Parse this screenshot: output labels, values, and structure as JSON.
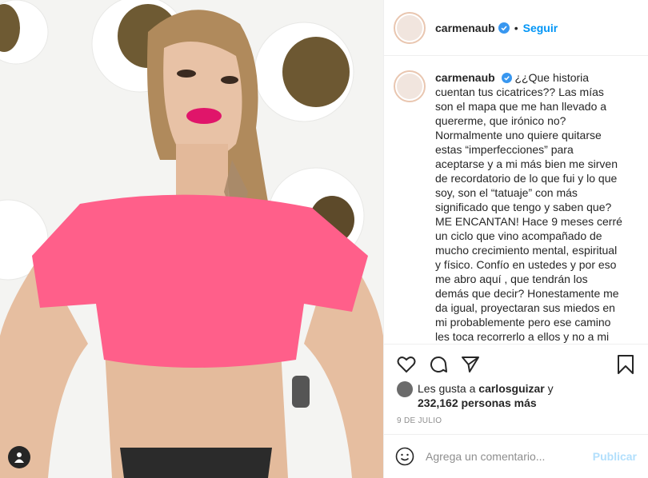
{
  "post": {
    "username": "carmenaub",
    "follow_label": "Seguir",
    "dot": "•",
    "caption_user": "carmenaub",
    "caption_lines": [
      "¿¿Que historia",
      "cuentan tus cicatrices?? Las mías",
      "son el mapa que me han llevado a",
      "quererme, que irónico no?",
      "Normalmente uno quiere quitarse",
      "estas “imperfecciones” para",
      "aceptarse y a mi más bien me sirven",
      "de recordatorio de lo que fui y lo que",
      "soy, son el “tatuaje” con más",
      "significado que tengo y saben que?",
      "ME ENCANTAN! Hace 9 meses cerré",
      "un ciclo que vino acompañado de",
      "mucho crecimiento mental, espiritual",
      "y físico. Confío en ustedes y por eso",
      "me abro aquí , que tendrán los",
      "demás que decir? Honestamente me",
      "da igual, proyectaran sus miedos en",
      "mi probablemente pero ese camino",
      "les toca recorrerlo a ellos y no a mi"
    ],
    "likes": {
      "prefix": "Les gusta a",
      "liker": "carlosguizar",
      "conj": "y",
      "count": "232,162 personas más"
    },
    "date": "9 DE JULIO",
    "comment_placeholder": "Agrega un comentario...",
    "publish_label": "Publicar"
  },
  "icons": {
    "verified": "verified-badge-icon",
    "like": "heart-icon",
    "comment": "comment-bubble-icon",
    "share": "paper-plane-icon",
    "save": "bookmark-icon",
    "emoji": "smiley-icon",
    "tags": "user-tag-icon"
  },
  "colors": {
    "link_blue": "#0095f6",
    "publish_disabled": "#b2dffc",
    "verified_blue": "#3897f0",
    "shirt_pink": "#ff5f8a"
  }
}
